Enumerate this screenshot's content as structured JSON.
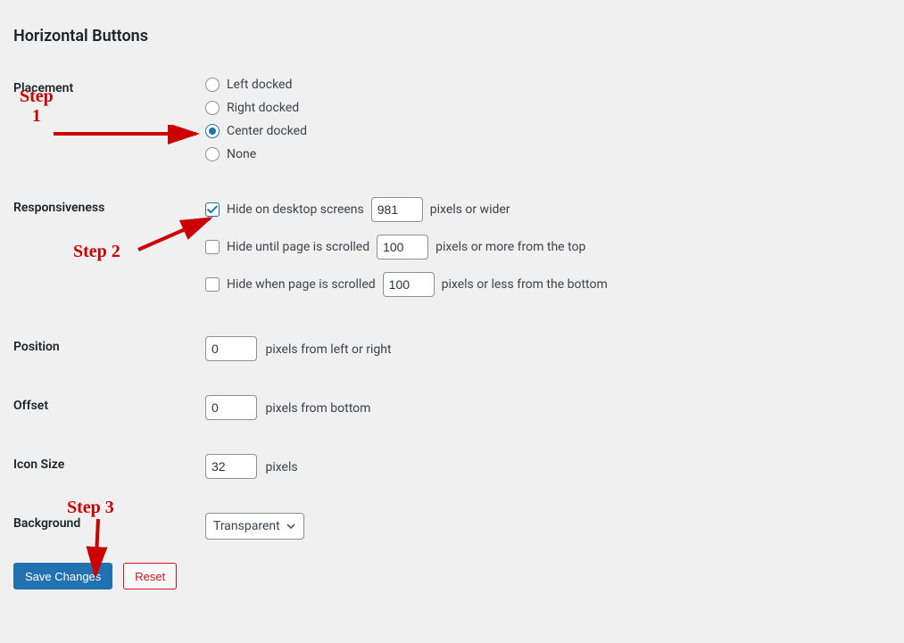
{
  "title": "Horizontal Buttons",
  "placement": {
    "label": "Placement",
    "options": {
      "left": "Left docked",
      "right": "Right docked",
      "center": "Center docked",
      "none": "None"
    },
    "selected": "center"
  },
  "responsiveness": {
    "label": "Responsiveness",
    "hideDesktop": {
      "labelBefore": "Hide on desktop screens",
      "value": "981",
      "labelAfter": "pixels or wider",
      "checked": true
    },
    "hideUntilScrolled": {
      "labelBefore": "Hide until page is scrolled",
      "value": "100",
      "labelAfter": "pixels or more from the top",
      "checked": false
    },
    "hideWhenBottom": {
      "labelBefore": "Hide when page is scrolled",
      "value": "100",
      "labelAfter": "pixels or less from the bottom",
      "checked": false
    }
  },
  "position": {
    "label": "Position",
    "value": "0",
    "suffix": "pixels from left or right"
  },
  "offset": {
    "label": "Offset",
    "value": "0",
    "suffix": "pixels from bottom"
  },
  "iconSize": {
    "label": "Icon Size",
    "value": "32",
    "suffix": "pixels"
  },
  "background": {
    "label": "Background",
    "selected": "Transparent"
  },
  "buttons": {
    "save": "Save Changes",
    "reset": "Reset"
  },
  "annotations": {
    "step1": "Step 1",
    "step2": "Step 2",
    "step3": "Step 3"
  }
}
